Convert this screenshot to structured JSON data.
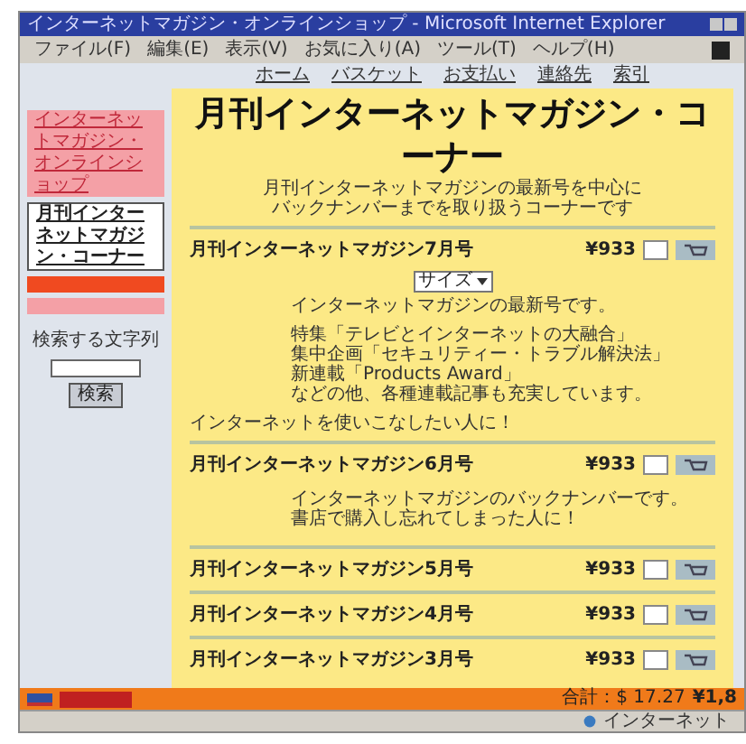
{
  "window": {
    "title": "インターネットマガジン・オンラインショップ - Microsoft Internet Explorer"
  },
  "menu": [
    "ファイル(F)",
    "編集(E)",
    "表示(V)",
    "お気に入り(A)",
    "ツール(T)",
    "ヘルプ(H)"
  ],
  "nav_links": [
    "ホーム",
    "バスケット",
    "お支払い",
    "連絡先",
    "索引"
  ],
  "sidebar": {
    "shop_link": "インターネットマガジン・オンラインショップ",
    "items": [
      {
        "label": "月刊インターネットマガジン・コーナー",
        "selected": true
      }
    ],
    "search_label": "検索する文字列",
    "search_button": "検索"
  },
  "main": {
    "title": "月刊インターネットマガジン・コーナー",
    "subtitle": [
      "月刊インターネットマガジンの最新号を中心に",
      "バックナンバーまでを取り扱うコーナーです"
    ],
    "products": [
      {
        "name": "月刊インターネットマガジン7月号",
        "price": "¥933",
        "size_label": "サイズ",
        "paragraphs": [
          [
            "インターネットマガジンの最新号です。"
          ],
          [
            "特集「テレビとインターネットの大融合」",
            "集中企画「セキュリティー・トラブル解決法」",
            "新連載「Products Award」",
            "などの他、各種連載記事も充実しています。"
          ]
        ],
        "note": "インターネットを使いこなしたい人に！"
      },
      {
        "name": "月刊インターネットマガジン6月号",
        "price": "¥933",
        "paragraphs": [
          [
            "インターネットマガジンのバックナンバーです。",
            "書店で購入し忘れてしまった人に！"
          ]
        ]
      },
      {
        "name": "月刊インターネットマガジン5月号",
        "price": "¥933"
      },
      {
        "name": "月刊インターネットマガジン4月号",
        "price": "¥933"
      },
      {
        "name": "月刊インターネットマガジン3月号",
        "price": "¥933"
      }
    ]
  },
  "footer": {
    "total": "合計：$ 17.27",
    "yen": "¥1,8"
  },
  "status_bar": {
    "zone": "インターネット"
  }
}
